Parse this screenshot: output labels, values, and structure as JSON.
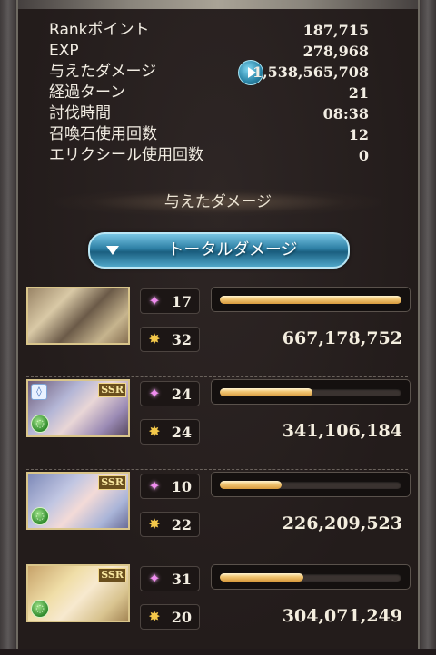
{
  "stats": [
    {
      "label": "Rankポイント",
      "value": "187,715"
    },
    {
      "label": "EXP",
      "value": "278,968"
    },
    {
      "label": "与えたダメージ",
      "value": "1,538,565,708",
      "has_play_button": true
    },
    {
      "label": "経過ターン",
      "value": "21"
    },
    {
      "label": "討伐時間",
      "value": "08:38"
    },
    {
      "label": "召喚石使用回数",
      "value": "12"
    },
    {
      "label": "エリクシール使用回数",
      "value": "0"
    }
  ],
  "damage_section": {
    "heading": "与えたダメージ",
    "dropdown_label": "トータルダメージ"
  },
  "characters": [
    {
      "portrait": "duo-character-portrait",
      "ssr": "",
      "star_count": "17",
      "ougi_count": "32",
      "damage": "667,178,752",
      "bar_fraction": 1.0
    },
    {
      "portrait": "character-portrait",
      "ssr": "SSR",
      "star_count": "24",
      "ougi_count": "24",
      "damage": "341,106,184",
      "bar_fraction": 0.51
    },
    {
      "portrait": "character-portrait",
      "ssr": "SSR",
      "star_count": "10",
      "ougi_count": "22",
      "damage": "226,209,523",
      "bar_fraction": 0.34
    },
    {
      "portrait": "character-portrait",
      "ssr": "SSR",
      "star_count": "31",
      "ougi_count": "20",
      "damage": "304,071,249",
      "bar_fraction": 0.46
    }
  ],
  "icons": {
    "play": "play-icon",
    "star": "star-icon",
    "ougi": "ougi-icon",
    "dropdown": "chevron-down-icon",
    "element_water": "water-element-icon",
    "element_wind": "wind-element-icon"
  },
  "colors": {
    "accent_blue": "#2c7ea3",
    "bar_gold": "#f2c877",
    "text_light": "#f2ede3"
  }
}
